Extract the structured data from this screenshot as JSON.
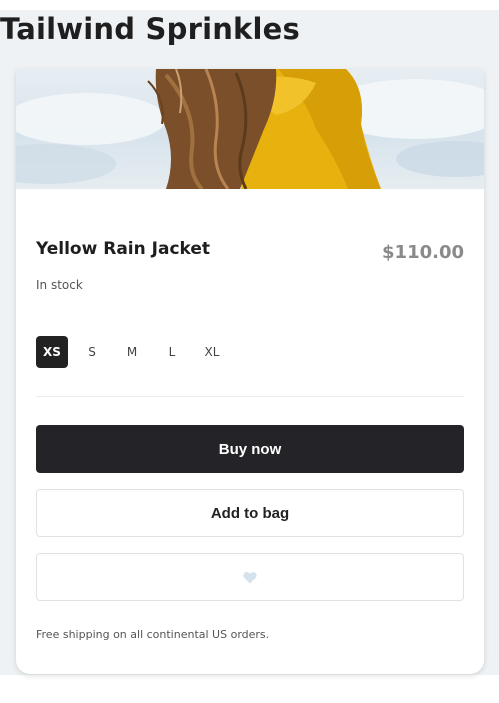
{
  "site": {
    "title": "Tailwind Sprinkles"
  },
  "product": {
    "name": "Yellow Rain Jacket",
    "price": "$110.00",
    "stock": "In stock",
    "image_alt": "woman-in-yellow-jacket"
  },
  "sizes": {
    "options": [
      "XS",
      "S",
      "M",
      "L",
      "XL"
    ],
    "selected": "XS"
  },
  "actions": {
    "buy_label": "Buy now",
    "bag_label": "Add to bag",
    "favorite_icon": "heart-icon"
  },
  "footer": {
    "shipping": "Free shipping on all continental US orders."
  },
  "colors": {
    "accent_dark": "#242428",
    "jacket_yellow": "#e8b20e",
    "heart": "#d6e3ec"
  }
}
